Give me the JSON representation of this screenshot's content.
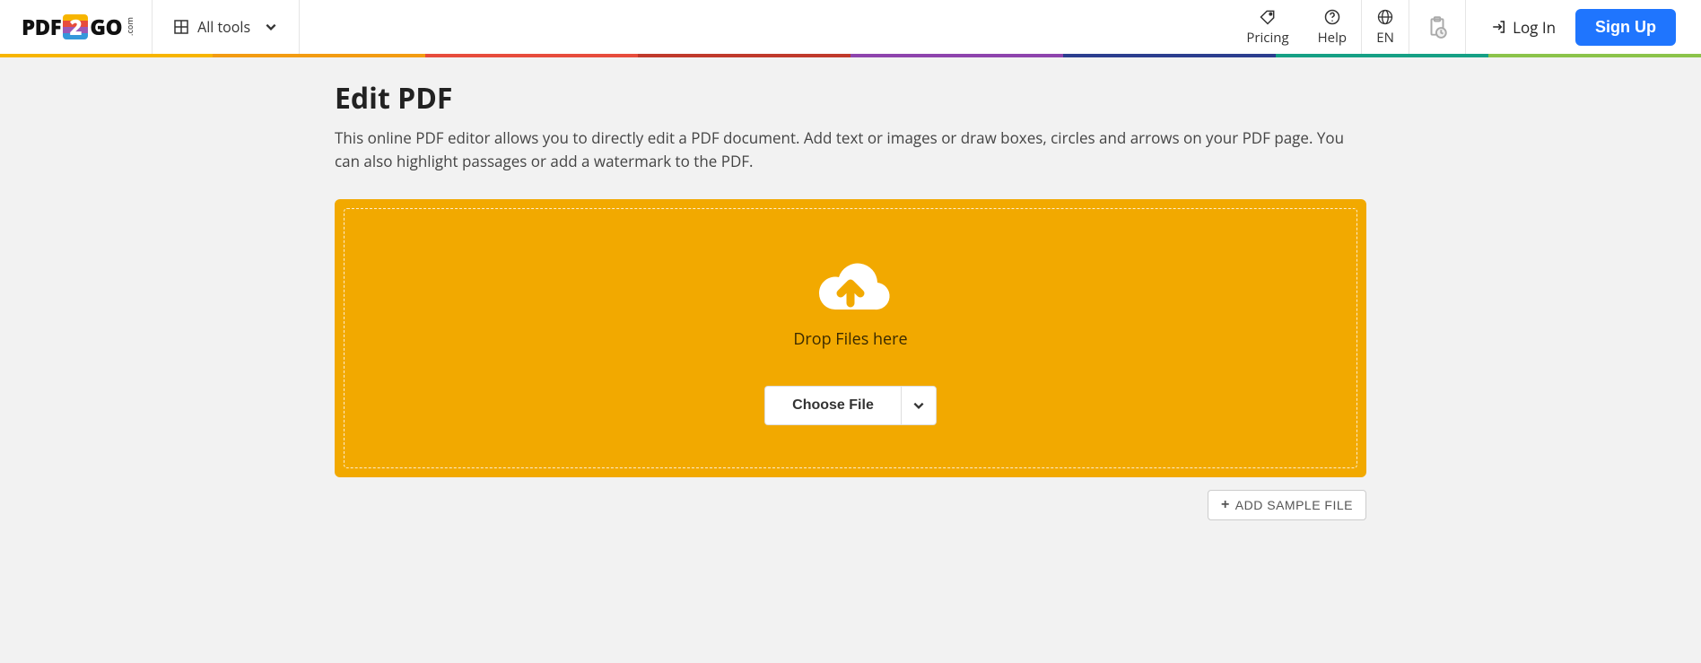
{
  "brand": {
    "pdf": "PDF",
    "two": "2",
    "go": "GO",
    "tld": ".com"
  },
  "nav": {
    "all_tools": "All tools",
    "pricing": "Pricing",
    "help": "Help",
    "language": "EN",
    "login": "Log In",
    "signup": "Sign Up"
  },
  "page": {
    "title": "Edit PDF",
    "subtitle": "This online PDF editor allows you to directly edit a PDF document. Add text or images or draw boxes, circles and arrows on your PDF page. You can also highlight passages or add a watermark to the PDF."
  },
  "drop": {
    "hint": "Drop Files here",
    "choose": "Choose File"
  },
  "sample": {
    "label": "ADD SAMPLE FILE"
  },
  "colors": {
    "accent": "#f2a900",
    "primary": "#1f75fe"
  }
}
